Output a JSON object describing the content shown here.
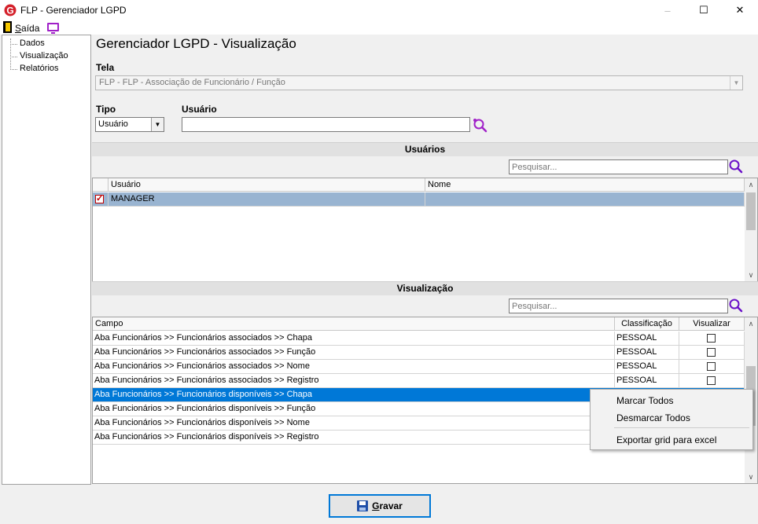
{
  "window": {
    "title": "FLP - Gerenciador LGPD",
    "minimize": "–",
    "maximize": "☐",
    "close": "✕"
  },
  "menu": {
    "exit_label_prefix": "S",
    "exit_label_rest": "aída"
  },
  "tree": {
    "items": [
      "Dados",
      "Visualização",
      "Relatórios"
    ]
  },
  "page": {
    "title": "Gerenciador LGPD - Visualização"
  },
  "tela": {
    "label": "Tela",
    "value": "FLP - FLP - Associação de Funcionário / Função"
  },
  "tipo": {
    "label": "Tipo",
    "value": "Usuário"
  },
  "usuario": {
    "label": "Usuário",
    "value": ""
  },
  "users_section": {
    "header": "Usuários",
    "search_placeholder": "Pesquisar...",
    "columns": [
      "Usuário",
      "Nome"
    ],
    "rows": [
      {
        "usuario": "MANAGER",
        "nome": "",
        "checked": true
      }
    ]
  },
  "view_section": {
    "header": "Visualização",
    "search_placeholder": "Pesquisar...",
    "columns": [
      "Campo",
      "Classificação",
      "Visualizar"
    ],
    "rows": [
      {
        "campo": "Aba Funcionários >> Funcionários associados >> Chapa",
        "classificacao": "PESSOAL",
        "visualizar": false
      },
      {
        "campo": "Aba Funcionários >> Funcionários associados >> Função",
        "classificacao": "PESSOAL",
        "visualizar": false
      },
      {
        "campo": "Aba Funcionários >> Funcionários associados >> Nome",
        "classificacao": "PESSOAL",
        "visualizar": false
      },
      {
        "campo": "Aba Funcionários >> Funcionários associados >> Registro",
        "classificacao": "PESSOAL",
        "visualizar": false
      },
      {
        "campo": "Aba Funcionários >> Funcionários disponíveis >> Chapa",
        "classificacao": "",
        "visualizar": null
      },
      {
        "campo": "Aba Funcionários >> Funcionários disponíveis >> Função",
        "classificacao": "",
        "visualizar": null
      },
      {
        "campo": "Aba Funcionários >> Funcionários disponíveis >> Nome",
        "classificacao": "",
        "visualizar": null
      },
      {
        "campo": "Aba Funcionários >> Funcionários disponíveis >> Registro",
        "classificacao": "",
        "visualizar": null
      }
    ]
  },
  "context_menu": {
    "items": [
      "Marcar Todos",
      "Desmarcar Todos",
      "Exportar grid para excel"
    ]
  },
  "actions": {
    "save_prefix": "G",
    "save_rest": "ravar"
  },
  "colors": {
    "accent": "#0078d7",
    "selection_gray": "#99b4d1",
    "search_icon": "#a020c8",
    "logo": "#d4202a"
  }
}
